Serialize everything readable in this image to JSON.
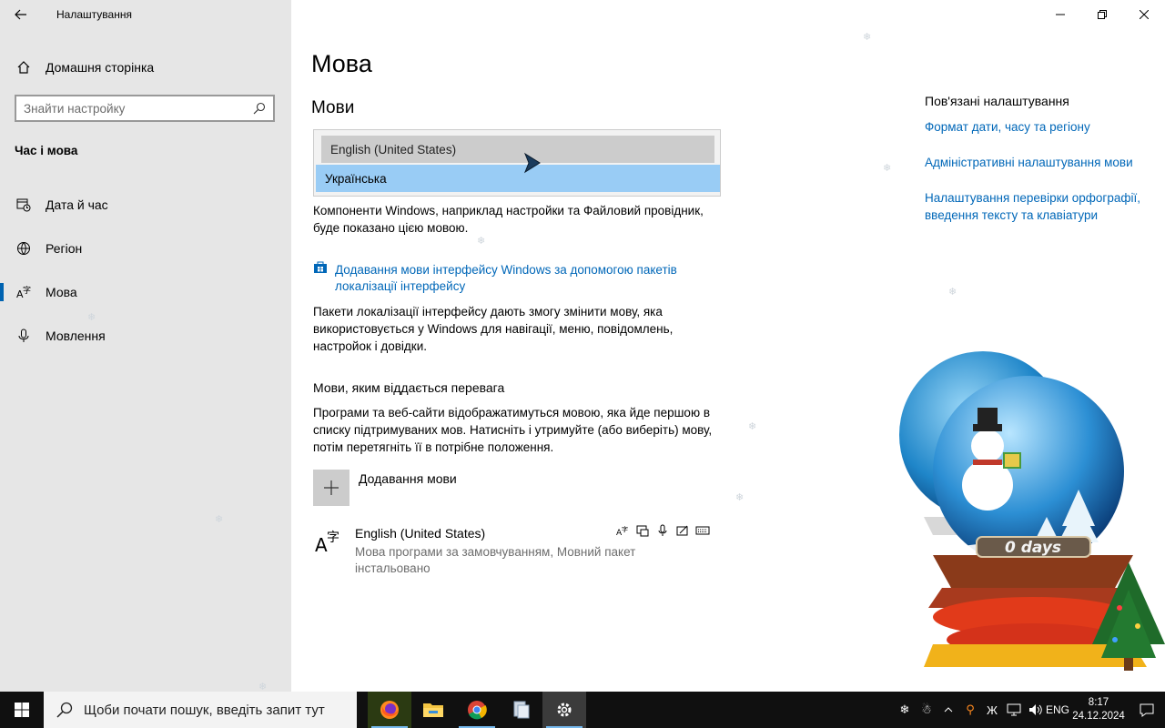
{
  "window": {
    "title": "Налаштування",
    "controls": [
      "minimize",
      "restore",
      "close"
    ]
  },
  "sidebar": {
    "home_label": "Домашня сторінка",
    "search_placeholder": "Знайти настройку",
    "section_title": "Час і мова",
    "items": [
      {
        "label": "Дата й час",
        "icon": "calendar-clock-icon"
      },
      {
        "label": "Регіон",
        "icon": "globe-icon"
      },
      {
        "label": "Мова",
        "icon": "language-icon",
        "selected": true
      },
      {
        "label": "Мовлення",
        "icon": "microphone-icon"
      }
    ]
  },
  "main": {
    "page_title": "Мова",
    "section_title": "Мови",
    "dropdown": {
      "options": [
        "English (United States)",
        "Українська"
      ],
      "selected": "Українська"
    },
    "display_desc": "Компоненти Windows, наприклад настройки та Файловий провідник, буде показано цією мовою.",
    "add_pack_link": "Додавання мови інтерфейсу Windows за допомогою пакетів локалізації інтерфейсу",
    "pack_desc": "Пакети локалізації інтерфейсу дають змогу змінити мову, яка використовується у Windows для навігації, меню, повідомлень, настройок і довідки.",
    "preferred_title": "Мови, яким віддається перевага",
    "preferred_desc": "Програми та веб-сайти відображатимуться мовою, яка йде першою в списку підтримуваних мов. Натисніть і утримуйте (або виберіть) мову, потім перетягніть її в потрібне положення.",
    "add_language_label": "Додавання мови",
    "language_entry": {
      "name": "English (United States)",
      "desc": "Мова програми за замовчуванням, Мовний пакет інстальовано"
    }
  },
  "related": {
    "title": "Пов'язані налаштування",
    "links": [
      "Формат дати, часу та регіону",
      "Адміністративні налаштування мови",
      "Налаштування перевірки орфографії, введення тексту та клавіатури"
    ]
  },
  "widget": {
    "counter_text": "0 days"
  },
  "taskbar": {
    "search_placeholder": "Щоби почати пошук, введіть запит тут",
    "apps": [
      "firefox-icon",
      "file-explorer-icon",
      "chrome-icon",
      "app-icon",
      "settings-icon"
    ],
    "time": "8:17",
    "date": "24.12.2024"
  },
  "colors": {
    "accent": "#0067b8",
    "sidebar_bg": "#e6e6e6",
    "taskbar_bg": "#101010"
  }
}
